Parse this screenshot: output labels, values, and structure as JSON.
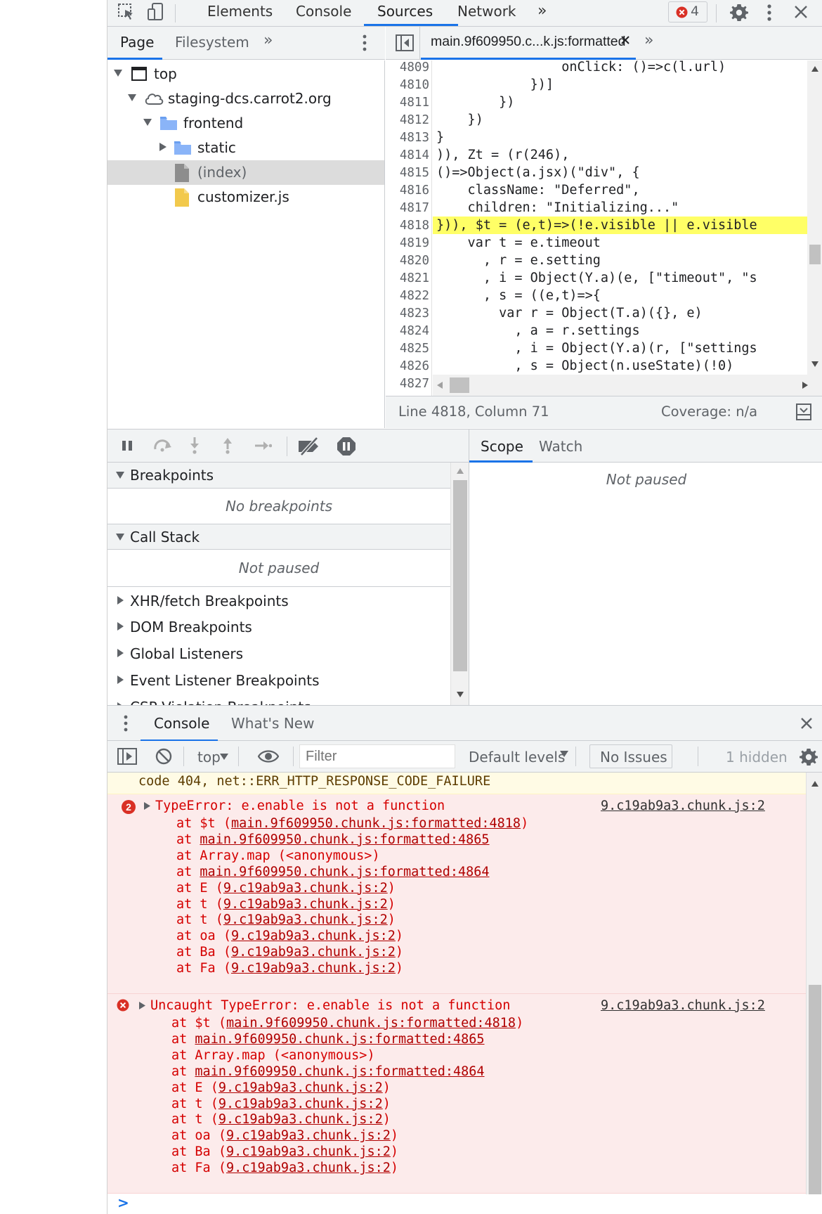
{
  "toolbar": {
    "tabs": [
      {
        "label": "Elements"
      },
      {
        "label": "Console"
      },
      {
        "label": "Sources"
      },
      {
        "label": "Network"
      }
    ],
    "active_tab": "Sources",
    "more_label": "»",
    "error_count": "4"
  },
  "navigator": {
    "tabs": [
      {
        "label": "Page"
      },
      {
        "label": "Filesystem"
      }
    ],
    "more_label": "»",
    "tree": [
      {
        "label": "top"
      },
      {
        "label": "staging-dcs.carrot2.org"
      },
      {
        "label": "frontend"
      },
      {
        "label": "static"
      },
      {
        "label": "(index)"
      },
      {
        "label": "customizer.js"
      }
    ]
  },
  "editor": {
    "tab_label": "main.9f609950.c...k.js:formatted",
    "more_label": "»",
    "lines": [
      {
        "n": "4809",
        "code": "                onClick: ()=>c(l.url)"
      },
      {
        "n": "4810",
        "code": "            })]"
      },
      {
        "n": "4811",
        "code": "        })"
      },
      {
        "n": "4812",
        "code": "    })"
      },
      {
        "n": "4813",
        "code": "}"
      },
      {
        "n": "4814",
        "code": ")), Zt = (r(246),"
      },
      {
        "n": "4815",
        "code": "()=>Object(a.jsx)(\"div\", {"
      },
      {
        "n": "4816",
        "code": "    className: \"Deferred\","
      },
      {
        "n": "4817",
        "code": "    children: \"Initializing...\""
      },
      {
        "n": "4818",
        "code": "})), $t = (e,t)=>(!e.visible || e.visible"
      },
      {
        "n": "4819",
        "code": "    var t = e.timeout"
      },
      {
        "n": "4820",
        "code": "      , r = e.setting"
      },
      {
        "n": "4821",
        "code": "      , i = Object(Y.a)(e, [\"timeout\", \"s"
      },
      {
        "n": "4822",
        "code": "      , s = ((e,t)=>{"
      },
      {
        "n": "4823",
        "code": "        var r = Object(T.a)({}, e)"
      },
      {
        "n": "4824",
        "code": "          , a = r.settings"
      },
      {
        "n": "4825",
        "code": "          , i = Object(Y.a)(r, [\"settings"
      },
      {
        "n": "4826",
        "code": "          , s = Object(n.useState)(!0)"
      },
      {
        "n": "4827",
        "code": ""
      }
    ],
    "status_position": "Line 4818, Column 71",
    "status_coverage": "Coverage: n/a"
  },
  "debugger": {
    "breakpoints_label": "Breakpoints",
    "no_breakpoints": "No breakpoints",
    "callstack_label": "Call Stack",
    "not_paused": "Not paused",
    "collapsed_sections": [
      {
        "label": "XHR/fetch Breakpoints"
      },
      {
        "label": "DOM Breakpoints"
      },
      {
        "label": "Global Listeners"
      },
      {
        "label": "Event Listener Breakpoints"
      },
      {
        "label": "CSP Violation Breakpoints"
      }
    ],
    "scope_tabs": [
      {
        "label": "Scope"
      },
      {
        "label": "Watch"
      }
    ],
    "scope_not_paused": "Not paused"
  },
  "drawer": {
    "tabs": [
      {
        "label": "Console"
      },
      {
        "label": "What's New"
      }
    ],
    "context": "top",
    "filter_placeholder": "Filter",
    "levels": "Default levels",
    "issues": "No Issues",
    "hidden": "1 hidden"
  },
  "console": {
    "warning_text": "code 404, net::ERR_HTTP_RESPONSE_CODE_FAILURE",
    "errors": [
      {
        "badge": "2",
        "title": "TypeError: e.enable is not a function",
        "source": "9.c19ab9a3.chunk.js:2",
        "frames": [
          {
            "pre": "at $t (",
            "link": "main.9f609950.chunk.js:formatted:4818",
            "post": ")"
          },
          {
            "pre": "at ",
            "link": "main.9f609950.chunk.js:formatted:4865",
            "post": ""
          },
          {
            "pre": "at Array.map (<anonymous>)",
            "link": "",
            "post": ""
          },
          {
            "pre": "at ",
            "link": "main.9f609950.chunk.js:formatted:4864",
            "post": ""
          },
          {
            "pre": "at E (",
            "link": "9.c19ab9a3.chunk.js:2",
            "post": ")"
          },
          {
            "pre": "at t (",
            "link": "9.c19ab9a3.chunk.js:2",
            "post": ")"
          },
          {
            "pre": "at t (",
            "link": "9.c19ab9a3.chunk.js:2",
            "post": ")"
          },
          {
            "pre": "at oa (",
            "link": "9.c19ab9a3.chunk.js:2",
            "post": ")"
          },
          {
            "pre": "at Ba (",
            "link": "9.c19ab9a3.chunk.js:2",
            "post": ")"
          },
          {
            "pre": "at Fa (",
            "link": "9.c19ab9a3.chunk.js:2",
            "post": ")"
          }
        ]
      },
      {
        "badge": "",
        "title": "Uncaught TypeError: e.enable is not a function",
        "source": "9.c19ab9a3.chunk.js:2",
        "frames": [
          {
            "pre": "at $t (",
            "link": "main.9f609950.chunk.js:formatted:4818",
            "post": ")"
          },
          {
            "pre": "at ",
            "link": "main.9f609950.chunk.js:formatted:4865",
            "post": ""
          },
          {
            "pre": "at Array.map (<anonymous>)",
            "link": "",
            "post": ""
          },
          {
            "pre": "at ",
            "link": "main.9f609950.chunk.js:formatted:4864",
            "post": ""
          },
          {
            "pre": "at E (",
            "link": "9.c19ab9a3.chunk.js:2",
            "post": ")"
          },
          {
            "pre": "at t (",
            "link": "9.c19ab9a3.chunk.js:2",
            "post": ")"
          },
          {
            "pre": "at t (",
            "link": "9.c19ab9a3.chunk.js:2",
            "post": ")"
          },
          {
            "pre": "at oa (",
            "link": "9.c19ab9a3.chunk.js:2",
            "post": ")"
          },
          {
            "pre": "at Ba (",
            "link": "9.c19ab9a3.chunk.js:2",
            "post": ")"
          },
          {
            "pre": "at Fa (",
            "link": "9.c19ab9a3.chunk.js:2",
            "post": ")"
          }
        ]
      }
    ],
    "prompt": ">"
  },
  "colors": {
    "accent": "#1a73e8",
    "error_text": "#d50000",
    "error_bg": "#fcebeb",
    "warning_bg": "#fffbe5",
    "highlight": "#ffff66"
  }
}
